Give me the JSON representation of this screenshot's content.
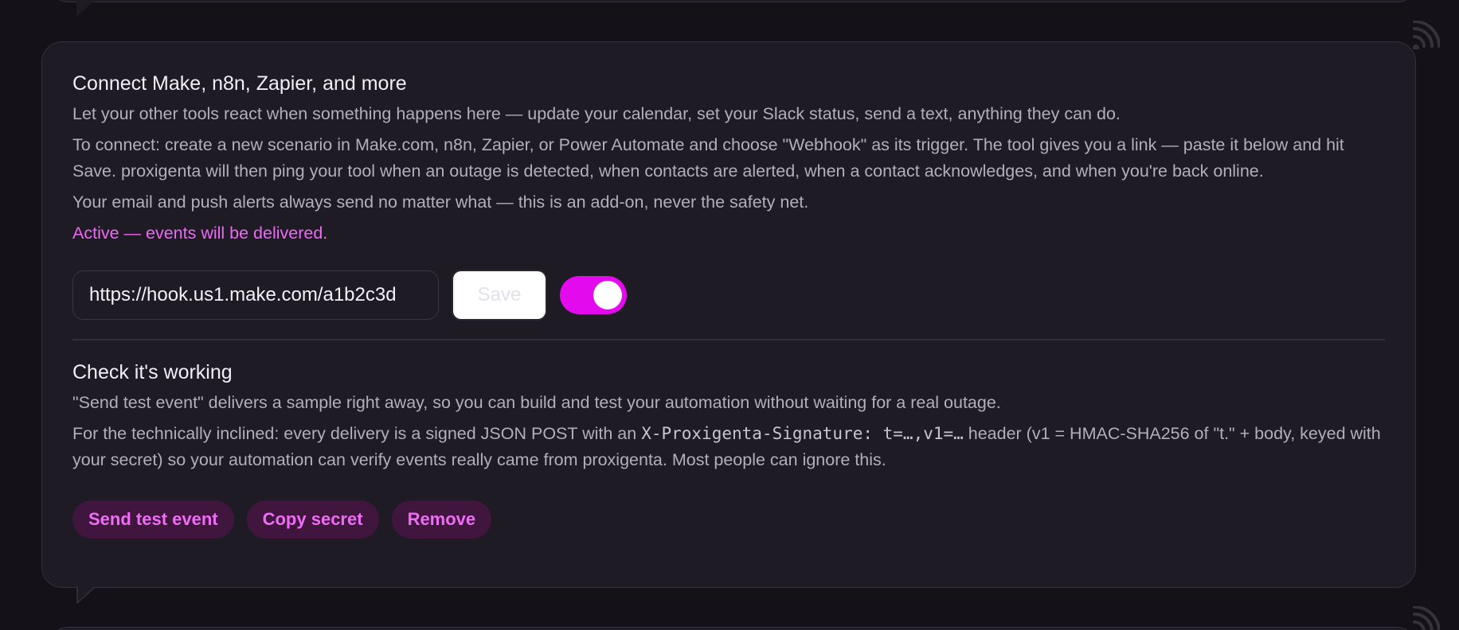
{
  "webhook": {
    "title": "Connect Make, n8n, Zapier, and more",
    "intro": "Let your other tools react when something happens here — update your calendar, set your Slack status, send a text, anything they can do.",
    "instructions": "To connect: create a new scenario in Make.com, n8n, Zapier, or Power Automate and choose \"Webhook\" as its trigger. The tool gives you a link — paste it below and hit Save. proxigenta will then ping your tool when an outage is detected, when contacts are alerted, when a contact acknowledges, and when you're back online.",
    "safety_note": "Your email and push alerts always send no matter what — this is an add-on, never the safety net.",
    "status": "Active — events will be delivered.",
    "url_value": "https://hook.us1.make.com/a1b2c3d",
    "save_label": "Save",
    "enabled": true
  },
  "check": {
    "title": "Check it's working",
    "test_desc": "\"Send test event\" delivers a sample right away, so you can build and test your automation without waiting for a real outage.",
    "tech_prefix": "For the technically inclined: every delivery is a signed JSON POST with an ",
    "tech_code": "X-Proxigenta-Signature: t=…,v1=…",
    "tech_suffix": " header (v1 = HMAC-SHA256 of \"t.\" + body, keyed with your secret) so your automation can verify events really came from proxigenta. Most people can ignore this."
  },
  "actions": {
    "send_test": "Send test event",
    "copy_secret": "Copy secret",
    "remove": "Remove"
  },
  "colors": {
    "accent": "#e40aee",
    "accent_text": "#ec6af5",
    "pill_bg": "#40163f",
    "card_bg": "#1e1b24",
    "page_bg": "#141218"
  },
  "icons": {
    "feed": "rss-feed-icon"
  }
}
